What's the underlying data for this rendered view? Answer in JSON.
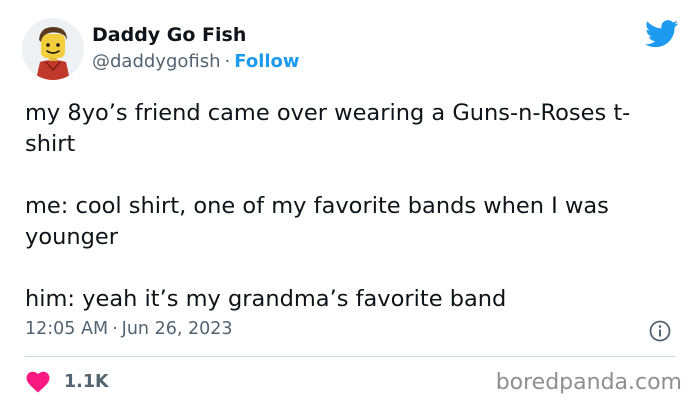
{
  "author": {
    "name": "Daddy Go Fish",
    "handle": "@daddygofish",
    "separator": "·",
    "follow_label": "Follow",
    "avatar_icon": "lego-minifigure-avatar"
  },
  "brand_icon": "twitter-bird-icon",
  "tweet": {
    "paragraphs": [
      "my 8yo’s friend came over wearing a Guns-n-Roses t-shirt",
      "me: cool shirt, one of my favorite bands when I was younger",
      "him: yeah it’s my grandma’s favorite band"
    ]
  },
  "meta": {
    "time": "12:05 AM",
    "separator": "·",
    "date": "Jun 26, 2023",
    "info_icon": "info-icon"
  },
  "engagement": {
    "like_icon": "heart-icon",
    "like_count": "1.1K"
  },
  "watermark": "boredpanda.com",
  "colors": {
    "accent": "#1d9bf0",
    "heart": "#f91880",
    "text": "#0f1419",
    "muted": "#536471",
    "divider": "#cfd9de"
  }
}
